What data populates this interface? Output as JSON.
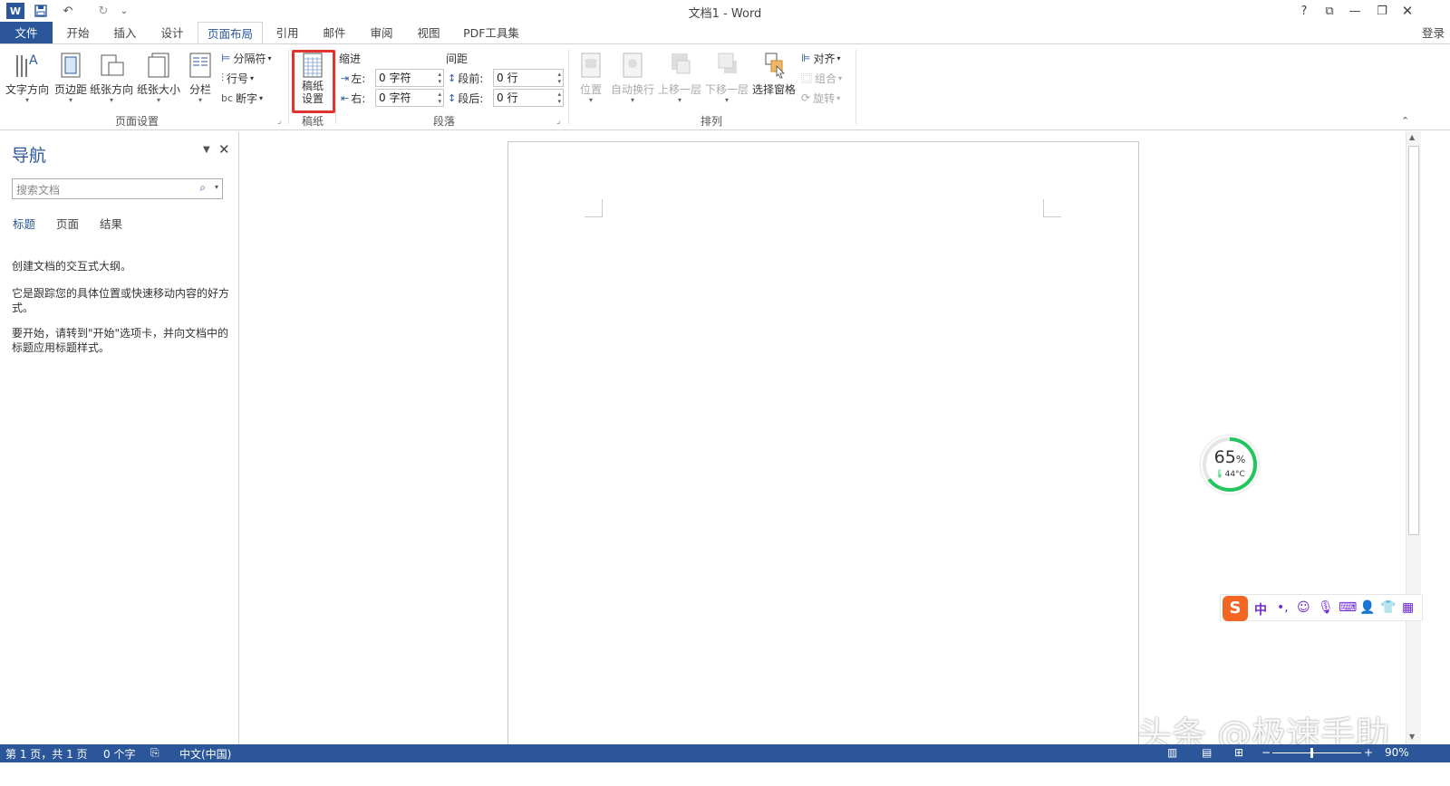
{
  "window": {
    "title": "文档1 - Word",
    "controls": [
      "?",
      "⧉",
      "—",
      "❐",
      "✕"
    ]
  },
  "qat": {
    "word_icon": "W",
    "save_icon": "💾",
    "undo_icon": "↶",
    "redo_icon": "↻",
    "more_icon": "⌄"
  },
  "tabs": [
    "文件",
    "开始",
    "插入",
    "设计",
    "页面布局",
    "引用",
    "邮件",
    "审阅",
    "视图",
    "PDF工具集"
  ],
  "login": "登录",
  "ribbon": {
    "page_setup": {
      "label": "页面设置",
      "text_direction": "文字方向",
      "margins": "页边距",
      "orientation": "纸张方向",
      "size": "纸张大小",
      "columns": "分栏",
      "breaks": "分隔符",
      "line_numbers": "行号",
      "hyphenation": "断字"
    },
    "manuscript": {
      "label": "稿纸",
      "setup_line1": "稿纸",
      "setup_line2": "设置"
    },
    "paragraph": {
      "label": "段落",
      "indent_header": "缩进",
      "spacing_header": "间距",
      "indent_left_label": "左:",
      "indent_left_value": "0 字符",
      "indent_right_label": "右:",
      "indent_right_value": "0 字符",
      "spacing_before_label": "段前:",
      "spacing_before_value": "0 行",
      "spacing_after_label": "段后:",
      "spacing_after_value": "0 行"
    },
    "arrange": {
      "label": "排列",
      "position": "位置",
      "wrap_text": "自动换行",
      "bring_forward": "上移一层",
      "send_backward": "下移一层",
      "selection_pane": "选择窗格",
      "align": "对齐",
      "group": "组合",
      "rotate": "旋转"
    }
  },
  "nav": {
    "title": "导航",
    "search_placeholder": "搜索文档",
    "tabs": [
      "标题",
      "页面",
      "结果"
    ],
    "msg1": "创建文档的交互式大纲。",
    "msg2": "它是跟踪您的具体位置或快速移动内容的好方式。",
    "msg3": "要开始，请转到\"开始\"选项卡，并向文档中的标题应用标题样式。"
  },
  "status": {
    "page": "第 1 页，共 1 页",
    "words": "0 个字",
    "language": "中文(中国)",
    "zoom": "90%",
    "zoom_value": 90
  },
  "gauge": {
    "value": "65",
    "unit": "%",
    "percent": 65,
    "temp": "44°C"
  },
  "ime": {
    "logo": "S",
    "mode": "中",
    "punct": "•,",
    "items": [
      "☺",
      "🎙",
      "⌨",
      "👤",
      "👕",
      "▦"
    ]
  },
  "watermark": "头条 @极速手助",
  "colors": {
    "accent": "#2b579a",
    "highlight": "#e0342f",
    "gauge": "#22c55e",
    "ime": "#6f2bd4"
  }
}
